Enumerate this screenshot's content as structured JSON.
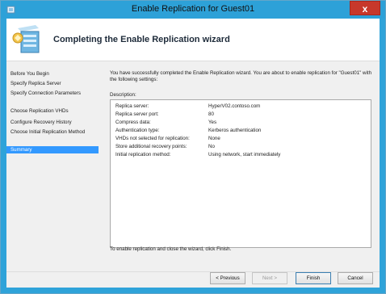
{
  "window": {
    "title": "Enable Replication for Guest01",
    "close_glyph": "x"
  },
  "header": {
    "heading": "Completing the Enable Replication wizard",
    "icon": "replication-wizard-icon"
  },
  "nav": {
    "items": [
      {
        "label": "Before You Begin"
      },
      {
        "label": "Specify Replica Server"
      },
      {
        "label": "Specify Connection Parameters"
      },
      {
        "label": "Choose Replication VHDs"
      },
      {
        "label": "Configure Recovery History"
      },
      {
        "label": "Choose Initial Replication Method"
      },
      {
        "label": "Summary",
        "selected": true
      }
    ]
  },
  "main": {
    "intro": "You have successfully completed the Enable Replication wizard. You are about to enable replication for \"Guest01\" with the following settings:",
    "description_label": "Description:",
    "settings": [
      {
        "key": "Replica server:",
        "value": "HyperV02.contoso.com"
      },
      {
        "key": "Replica server port:",
        "value": "80"
      },
      {
        "key": "Compress data:",
        "value": "Yes"
      },
      {
        "key": "Authentication type:",
        "value": "Kerberos authentication"
      },
      {
        "key": "VHDs not selected for replication:",
        "value": "None"
      },
      {
        "key": "Store additional recovery points:",
        "value": "No"
      },
      {
        "key": "Initial replication method:",
        "value": "Using network, start immediately"
      }
    ],
    "outro": "To enable replication and close the wizard, click Finish."
  },
  "buttons": {
    "previous": "< Previous",
    "next": "Next >",
    "finish": "Finish",
    "cancel": "Cancel"
  },
  "colors": {
    "titlebar": "#2da1d8",
    "selection": "#3399ff",
    "close": "#c7382b"
  }
}
